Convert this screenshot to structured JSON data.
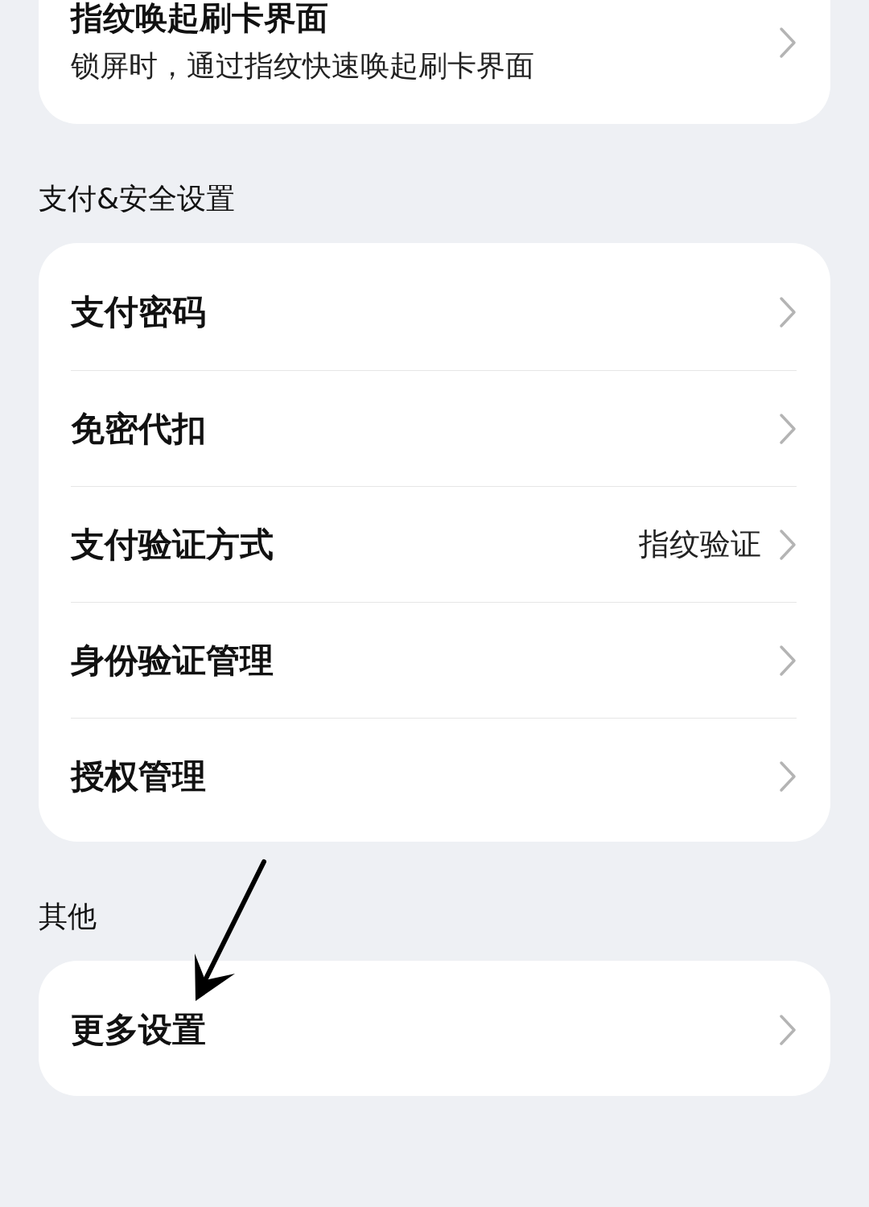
{
  "sections": [
    {
      "items": [
        {
          "label": "指纹唤起刷卡界面",
          "subtitle": "锁屏时，通过指纹快速唤起刷卡界面"
        }
      ]
    },
    {
      "header": "支付&安全设置",
      "items": [
        {
          "label": "支付密码"
        },
        {
          "label": "免密代扣"
        },
        {
          "label": "支付验证方式",
          "value": "指纹验证"
        },
        {
          "label": "身份验证管理"
        },
        {
          "label": "授权管理"
        }
      ]
    },
    {
      "header": "其他",
      "items": [
        {
          "label": "更多设置"
        }
      ]
    }
  ]
}
